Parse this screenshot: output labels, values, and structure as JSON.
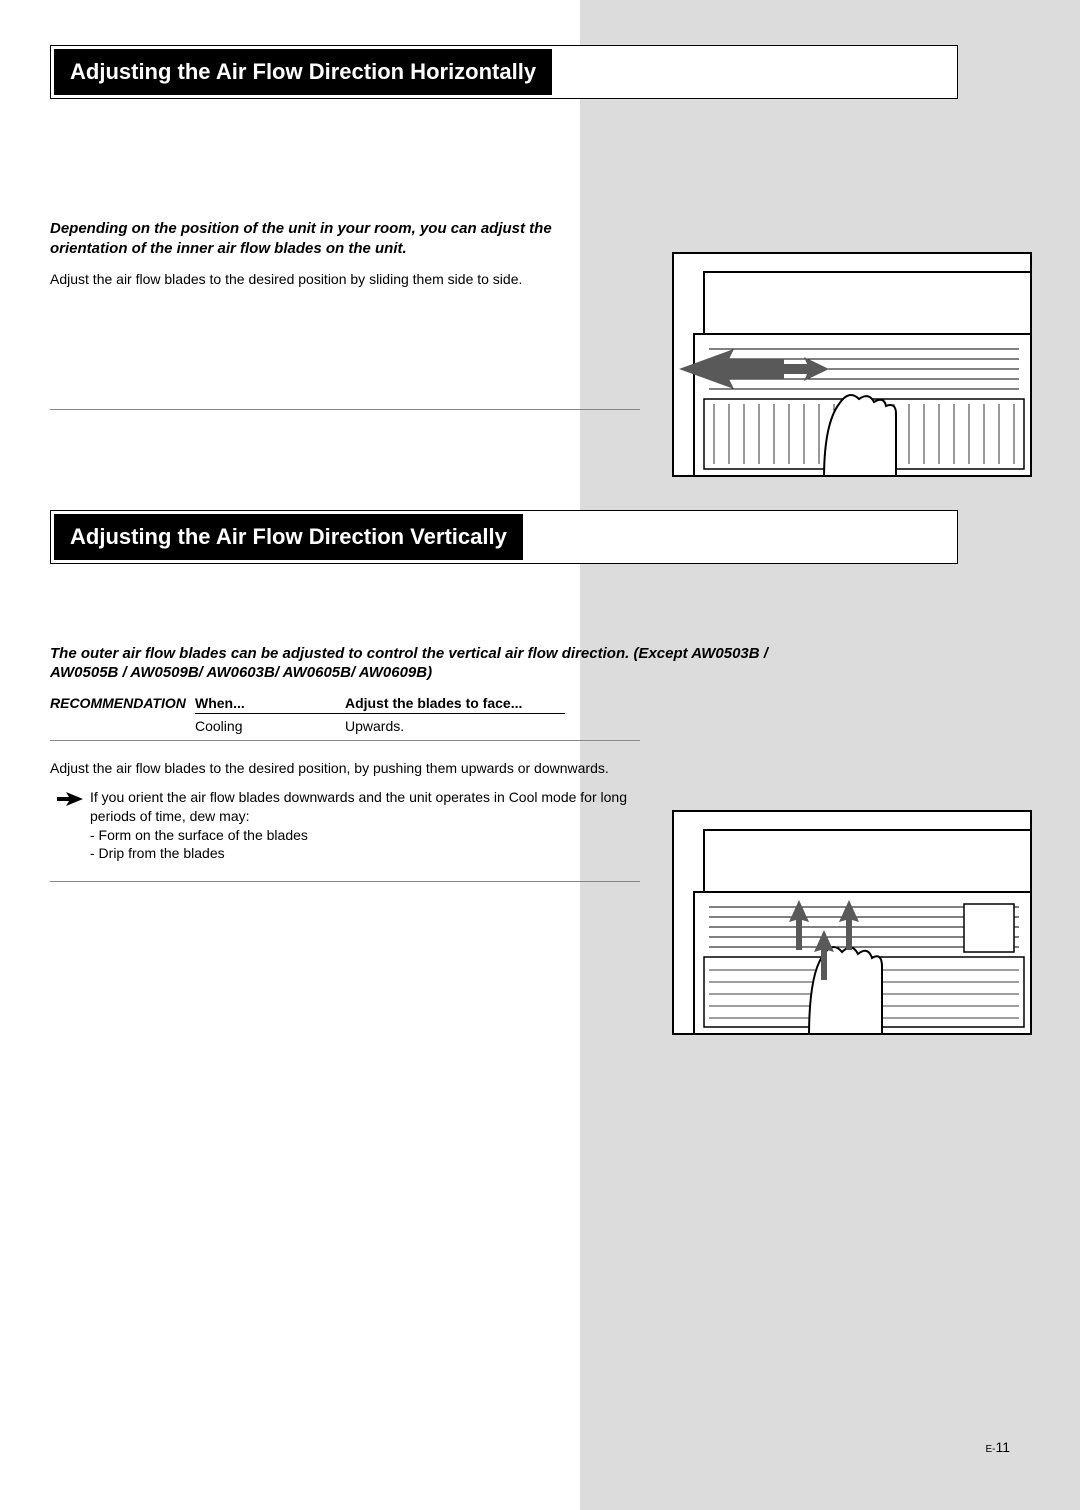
{
  "section1": {
    "title": "Adjusting the Air Flow Direction Horizontally",
    "intro": "Depending on the position of the unit in your room, you can adjust the orientation of the inner air flow blades on the unit.",
    "body": "Adjust the air flow blades to the desired position by sliding them side to side."
  },
  "section2": {
    "title": "Adjusting the Air Flow Direction Vertically",
    "intro": "The outer air flow blades can be adjusted to control the vertical air flow direction. (Except AW0503B / AW0505B / AW0509B/ AW0603B/ AW0605B/ AW0609B)",
    "rec_label": "RECOMMENDATION",
    "rec_header_when": "When...",
    "rec_header_adjust": "Adjust the blades to face...",
    "rec_when": "Cooling",
    "rec_adjust": "Upwards.",
    "body": "Adjust the air flow blades to the desired position, by pushing them upwards or downwards.",
    "note_line1": "If you orient the air flow blades downwards and the unit operates in Cool mode for long periods of time, dew may:",
    "note_bullet1": "- Form on the surface of the blades",
    "note_bullet2": "- Drip from the blades"
  },
  "page": {
    "prefix": "E-",
    "number": "11"
  }
}
